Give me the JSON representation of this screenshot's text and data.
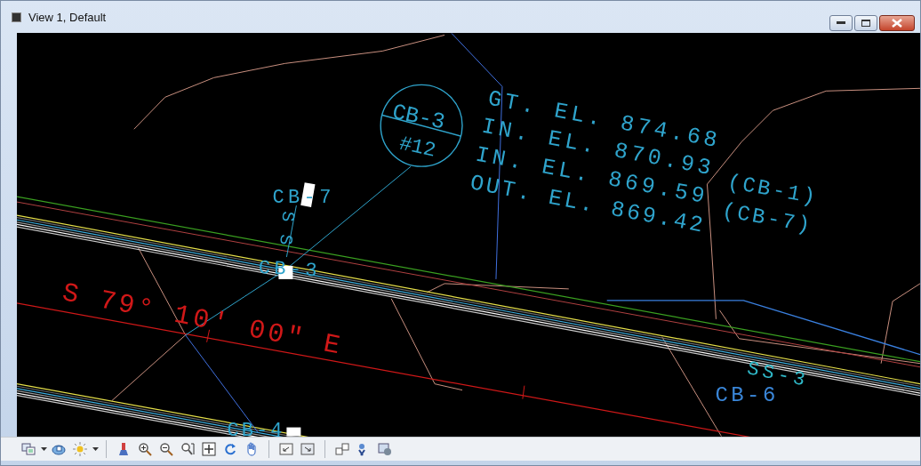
{
  "window": {
    "title": "View 1, Default"
  },
  "drawing": {
    "callout": {
      "top": "CB-3",
      "bottom": "#12"
    },
    "elevations": [
      {
        "text": "GT. EL. 874.68"
      },
      {
        "text": "IN. EL. 870.93"
      },
      {
        "text": "IN. EL. 869.59"
      },
      {
        "text": "OUT. EL. 869.42"
      }
    ],
    "pipe_refs": [
      {
        "text": "(CB-1)"
      },
      {
        "text": "(CB-7)"
      }
    ],
    "labels": [
      {
        "text": "CB-7",
        "color": "#2fa4cc"
      },
      {
        "text": "SS",
        "color": "#2fa4cc"
      },
      {
        "text": "CB-3",
        "color": "#2fa4cc"
      },
      {
        "text": "S 79° 10′ 00″ E",
        "color": "#d01818"
      },
      {
        "text": "CB-4",
        "color": "#2fa4cc"
      },
      {
        "text": "SS-3",
        "color": "#2fb8c8"
      },
      {
        "text": "CB-6",
        "color": "#3a86d8"
      }
    ]
  }
}
